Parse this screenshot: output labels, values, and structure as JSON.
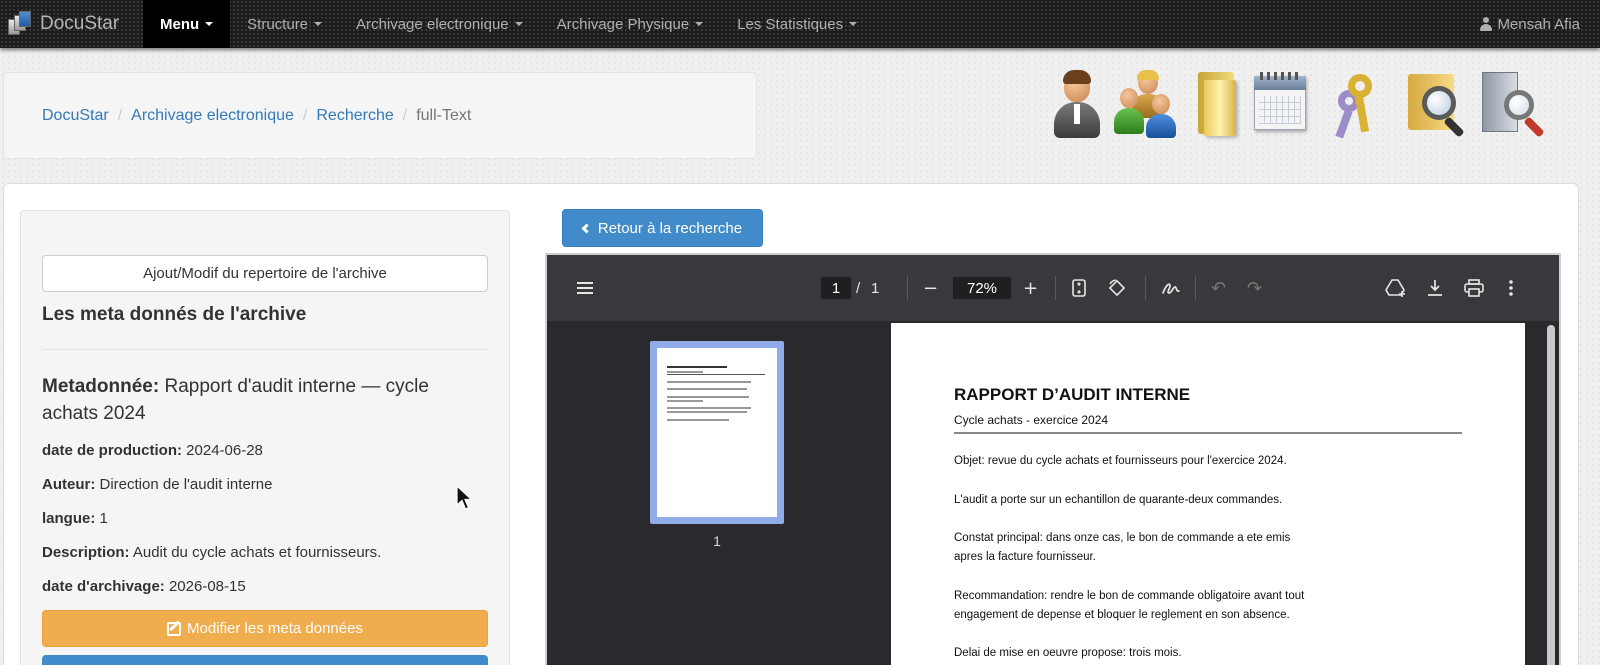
{
  "navbar": {
    "brand": "DocuStar",
    "items": [
      {
        "label": "Menu"
      },
      {
        "label": "Structure"
      },
      {
        "label": "Archivage electronique"
      },
      {
        "label": "Archivage Physique"
      },
      {
        "label": "Les Statistiques"
      }
    ],
    "user": "Mensah Afia"
  },
  "breadcrumb": {
    "items": [
      "DocuStar",
      "Archivage electronique",
      "Recherche"
    ],
    "current": "full-Text"
  },
  "toolbar_icons": [
    "user-icon",
    "group-icon",
    "folder-icon",
    "calendar-icon",
    "keys-icon",
    "folder-search-icon",
    "document-search-icon"
  ],
  "sidebar": {
    "repo_button": "Ajout/Modif du repertoire de l'archive",
    "section_title": "Les meta donnés de l'archive",
    "metadata_label": "Metadonnée:",
    "metadata_value": "Rapport d'audit interne — cycle achats 2024",
    "fields": [
      {
        "label": "date de production:",
        "value": "2024-06-28"
      },
      {
        "label": "Auteur:",
        "value": "Direction de l'audit interne"
      },
      {
        "label": "langue:",
        "value": "1"
      },
      {
        "label": "Description:",
        "value": "Audit du cycle achats et fournisseurs."
      },
      {
        "label": "date d'archivage:",
        "value": "2026-08-15"
      }
    ],
    "edit_button": "Modifier les meta données"
  },
  "back_button": "Retour à la recherche",
  "pdf": {
    "page_current": "1",
    "page_separator": "/",
    "page_total": "1",
    "zoom": "72%",
    "thumb_label": "1",
    "title": "RAPPORT D’AUDIT INTERNE",
    "subtitle": "Cycle achats - exercice 2024",
    "lines": [
      "Objet: revue du cycle achats et fournisseurs pour l'exercice 2024.",
      "L'audit a porte sur un echantillon de quarante-deux commandes.",
      "Constat principal: dans onze cas, le bon de commande a ete emis",
      "apres la facture fournisseur.",
      "Recommandation: rendre le bon de commande obligatoire avant tout",
      "engagement de depense et bloquer le reglement en son absence.",
      "Delai de mise en oeuvre propose: trois mois."
    ]
  },
  "colors": {
    "navbar_bg": "#1c1c1c",
    "link": "#337ab7",
    "primary_button": "#428bca",
    "warning_button": "#f0ad4e",
    "pdf_toolbar": "#38383d",
    "thumb_highlight": "#8fabe8"
  }
}
